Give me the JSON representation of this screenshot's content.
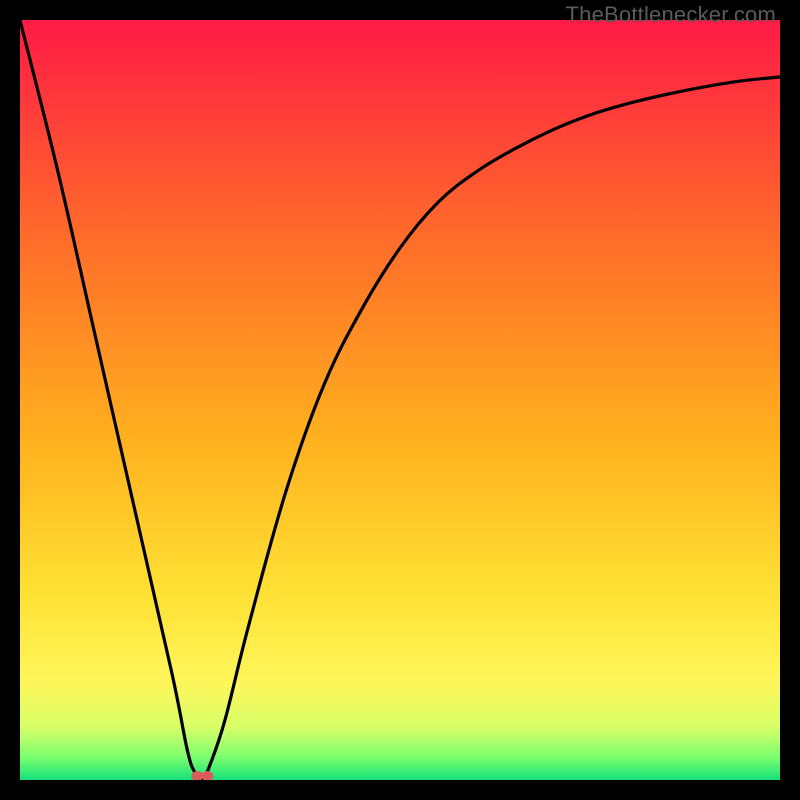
{
  "watermark": "TheBottlenecker.com",
  "colors": {
    "frame": "#000000",
    "curve": "#000000",
    "marker": "#db5a5a",
    "gradient_top": "#ff1a46",
    "gradient_mid1": "#ff7a1e",
    "gradient_mid2": "#ffd21e",
    "gradient_yellow": "#fff65a",
    "gradient_lightgreen": "#b6ff6e",
    "gradient_green": "#14e07a"
  },
  "chart_data": {
    "type": "line",
    "title": "",
    "xlabel": "",
    "ylabel": "",
    "xlim": [
      0,
      100
    ],
    "ylim": [
      0,
      100
    ],
    "series": [
      {
        "name": "bottleneck-curve",
        "x": [
          0,
          5,
          10,
          15,
          20,
          22,
          23,
          24,
          25,
          27,
          30,
          35,
          40,
          45,
          50,
          55,
          60,
          65,
          70,
          75,
          80,
          85,
          90,
          95,
          100
        ],
        "values": [
          100,
          80,
          58,
          36,
          14,
          4,
          1,
          0,
          2,
          8,
          20,
          38,
          52,
          62,
          70,
          76,
          80,
          83,
          85.5,
          87.5,
          89,
          90.2,
          91.2,
          92,
          92.5
        ]
      }
    ],
    "marker": {
      "x": 24,
      "y": 0,
      "name": "optimal-point"
    },
    "annotations": []
  }
}
